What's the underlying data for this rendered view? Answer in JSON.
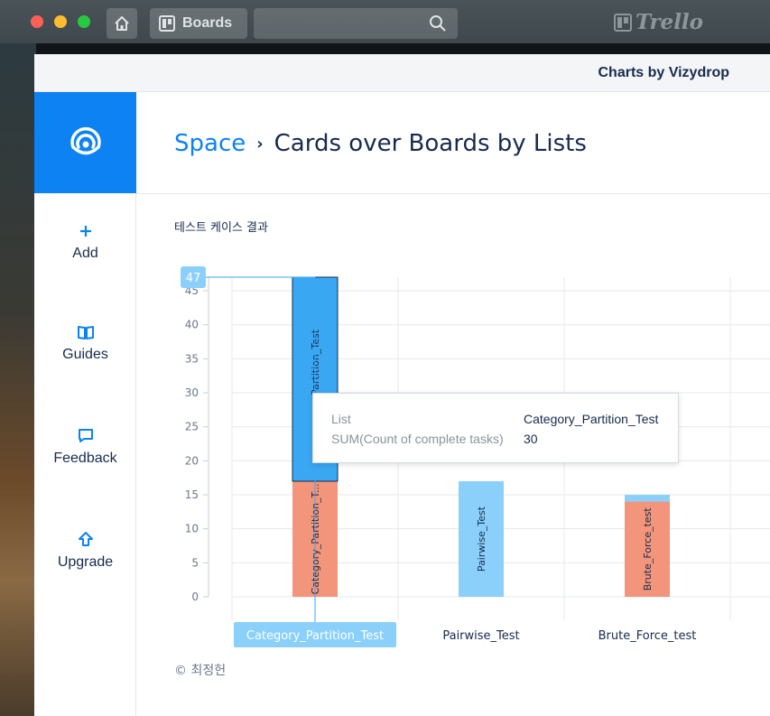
{
  "topbar": {
    "boards_label": "Boards",
    "logo_text": "Trello",
    "icons": [
      "home-icon",
      "boards-icon",
      "search-icon",
      "trello-logo-icon"
    ]
  },
  "modal": {
    "header_title": "Charts by Vizydrop"
  },
  "sidebar": {
    "logo_icon": "vizydrop-logo-icon",
    "items": [
      {
        "label": "Add",
        "icon": "plus-icon"
      },
      {
        "label": "Guides",
        "icon": "book-icon"
      },
      {
        "label": "Feedback",
        "icon": "speech-bubble-icon"
      },
      {
        "label": "Upgrade",
        "icon": "arrow-up-icon"
      }
    ]
  },
  "breadcrumb": {
    "root": "Space",
    "separator": "›",
    "current": "Cards over Boards by Lists"
  },
  "chart": {
    "title": "테스트 케이스 결과",
    "copyright": "© 최정헌",
    "crosshair_label": "47"
  },
  "tooltip": {
    "rows": [
      {
        "key": "List",
        "value": "Category_Partition_Test"
      },
      {
        "key": "SUM(Count of complete tasks)",
        "value": "30"
      }
    ]
  },
  "colors": {
    "accent": "#0d82f2",
    "series_blue": "#8bd0fb",
    "series_blue_highlight": "#3aa7f3",
    "series_orange": "#f2957a"
  },
  "chart_data": {
    "type": "bar",
    "stacked": true,
    "categories": [
      "Category_Partition_Test",
      "Pairwise_Test",
      "Brute_Force_test"
    ],
    "series": [
      {
        "color": "#f2957a",
        "values": [
          17,
          0,
          14
        ]
      },
      {
        "color": "#8bd0fb",
        "values": [
          30,
          17,
          1
        ]
      }
    ],
    "bar_labels": [
      [
        "Category_Partition_T...",
        "",
        "Brute_Force_test"
      ],
      [
        "egory_Partition_Test",
        "Pairwise_Test",
        ""
      ]
    ],
    "highlighted_category": 0,
    "highlighted_series": 1,
    "y_ticks": [
      0,
      5,
      10,
      15,
      20,
      25,
      30,
      35,
      40,
      45
    ],
    "ylim": [
      0,
      47
    ],
    "grid": true
  }
}
